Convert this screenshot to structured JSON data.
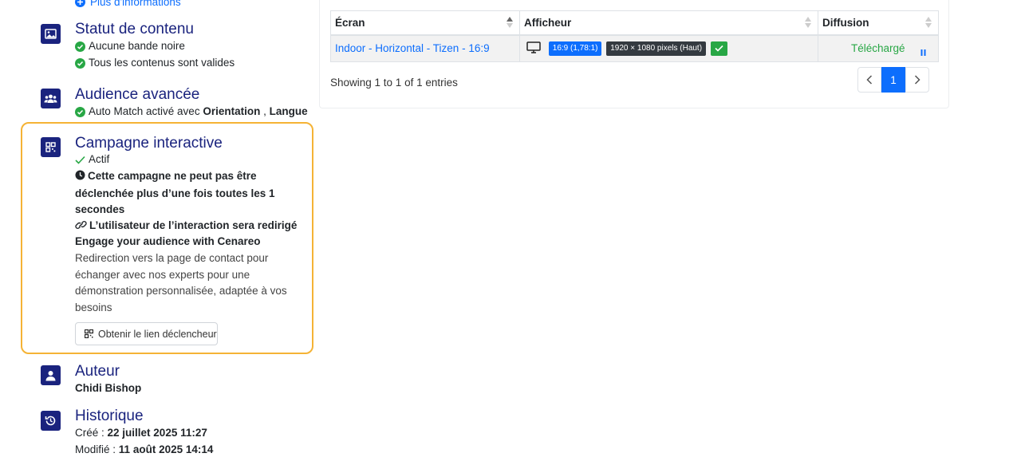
{
  "more_info": {
    "label": "Plus d'informations"
  },
  "content_status": {
    "title": "Statut de contenu",
    "items": [
      "Aucune bande noire",
      "Tous les contenus sont valides"
    ]
  },
  "advanced_audience": {
    "title": "Audience avancée",
    "prefix": "Auto Match activé avec",
    "criteria_1": "Orientation",
    "separator": ",",
    "criteria_2": "Langue"
  },
  "interactive_campaign": {
    "title": "Campagne interactive",
    "status": "Actif",
    "restriction": "Cette campagne ne peut pas être déclenchée plus d’une fois toutes les 1 secondes",
    "redirect_notice": "L’utilisateur de l’interaction sera redirigé",
    "redirect_title": "Engage your audience with Cenareo",
    "redirect_description": "Redirection vers la page de contact pour échanger avec nos experts pour une démonstration personnalisée, adaptée à vos besoins",
    "trigger_button": "Obtenir le lien déclencheur"
  },
  "author": {
    "title": "Auteur",
    "name": "Chidi Bishop"
  },
  "history": {
    "title": "Historique",
    "created_label": "Créé :",
    "created_value": "22 juillet 2025 11:27",
    "modified_label": "Modifié :",
    "modified_value": "11 août 2025 14:14"
  },
  "table": {
    "columns": [
      "Écran",
      "Afficheur",
      "Diffusion"
    ],
    "rows": [
      {
        "screen": "Indoor - Horizontal - Tizen - 16:9",
        "ratio_badge": "16:9 (1,78:1)",
        "resolution_badge": "1920 × 1080 pixels (Haut)",
        "diffusion": "Téléchargé"
      }
    ],
    "showing": "Showing 1 to 1 of 1 entries",
    "current_page": "1"
  },
  "colors": {
    "primary": "#1a237e",
    "link": "#0d6efd",
    "success": "#28a745",
    "highlight_border": "#f5b335"
  }
}
